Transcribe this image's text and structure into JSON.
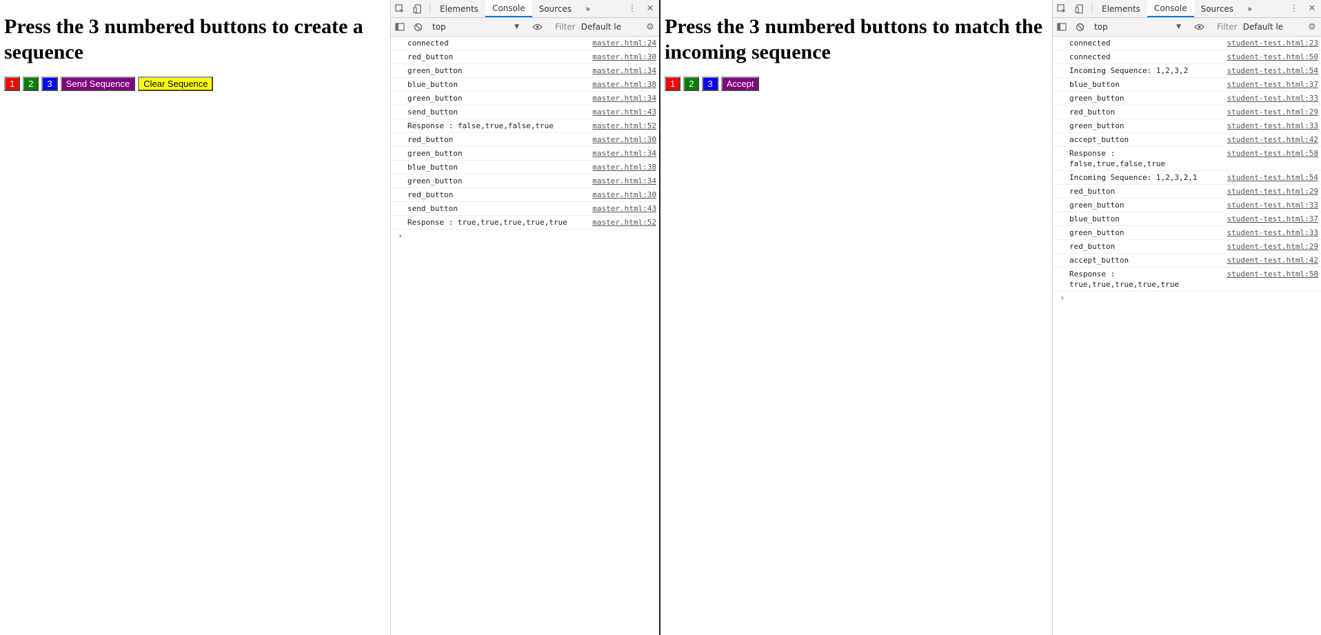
{
  "left_page": {
    "heading": "Press the 3 numbered buttons to create a sequence",
    "buttons": [
      {
        "label": "1",
        "color": "#ff0000"
      },
      {
        "label": "2",
        "color": "#008000"
      },
      {
        "label": "3",
        "color": "#0000ff"
      },
      {
        "label": "Send Sequence",
        "color": "#800080"
      },
      {
        "label": "Clear Sequence",
        "color": "#ffff00"
      }
    ]
  },
  "right_page": {
    "heading": "Press the 3 numbered buttons to match the incoming sequence",
    "buttons": [
      {
        "label": "1",
        "color": "#ff0000"
      },
      {
        "label": "2",
        "color": "#008000"
      },
      {
        "label": "3",
        "color": "#0000ff"
      },
      {
        "label": "Accept",
        "color": "#800080"
      }
    ]
  },
  "devtools": {
    "tabs": [
      "Elements",
      "Console",
      "Sources"
    ],
    "active_tab": "Console",
    "more_tabs": "»",
    "context": "top",
    "filter_placeholder": "Filter",
    "levels": "Default le",
    "prompt": "›"
  },
  "left_console": [
    {
      "msg": "connected",
      "src": "master.html:24"
    },
    {
      "msg": "red_button",
      "src": "master.html:30"
    },
    {
      "msg": "green_button",
      "src": "master.html:34"
    },
    {
      "msg": "blue_button",
      "src": "master.html:38"
    },
    {
      "msg": "green_button",
      "src": "master.html:34"
    },
    {
      "msg": "send_button",
      "src": "master.html:43"
    },
    {
      "msg": "Response : false,true,false,true",
      "src": "master.html:52"
    },
    {
      "msg": "red_button",
      "src": "master.html:30"
    },
    {
      "msg": "green_button",
      "src": "master.html:34"
    },
    {
      "msg": "blue_button",
      "src": "master.html:38"
    },
    {
      "msg": "green_button",
      "src": "master.html:34"
    },
    {
      "msg": "red_button",
      "src": "master.html:30"
    },
    {
      "msg": "send_button",
      "src": "master.html:43"
    },
    {
      "msg": "Response : true,true,true,true,true",
      "src": "master.html:52"
    }
  ],
  "right_console": [
    {
      "msg": "connected",
      "src": "student-test.html:23"
    },
    {
      "msg": "connected",
      "src": "student-test.html:50"
    },
    {
      "msg": "Incoming Sequence: 1,2,3,2",
      "src": "student-test.html:54"
    },
    {
      "msg": "blue_button",
      "src": "student-test.html:37"
    },
    {
      "msg": "green_button",
      "src": "student-test.html:33"
    },
    {
      "msg": "red_button",
      "src": "student-test.html:29"
    },
    {
      "msg": "green_button",
      "src": "student-test.html:33"
    },
    {
      "msg": "accept_button",
      "src": "student-test.html:42"
    },
    {
      "msg": "Response :\nfalse,true,false,true",
      "src": "student-test.html:58"
    },
    {
      "msg": "Incoming Sequence: 1,2,3,2,1",
      "src": "student-test.html:54"
    },
    {
      "msg": "red_button",
      "src": "student-test.html:29"
    },
    {
      "msg": "green_button",
      "src": "student-test.html:33"
    },
    {
      "msg": "blue_button",
      "src": "student-test.html:37"
    },
    {
      "msg": "green_button",
      "src": "student-test.html:33"
    },
    {
      "msg": "red_button",
      "src": "student-test.html:29"
    },
    {
      "msg": "accept_button",
      "src": "student-test.html:42"
    },
    {
      "msg": "Response :\ntrue,true,true,true,true",
      "src": "student-test.html:58"
    }
  ]
}
